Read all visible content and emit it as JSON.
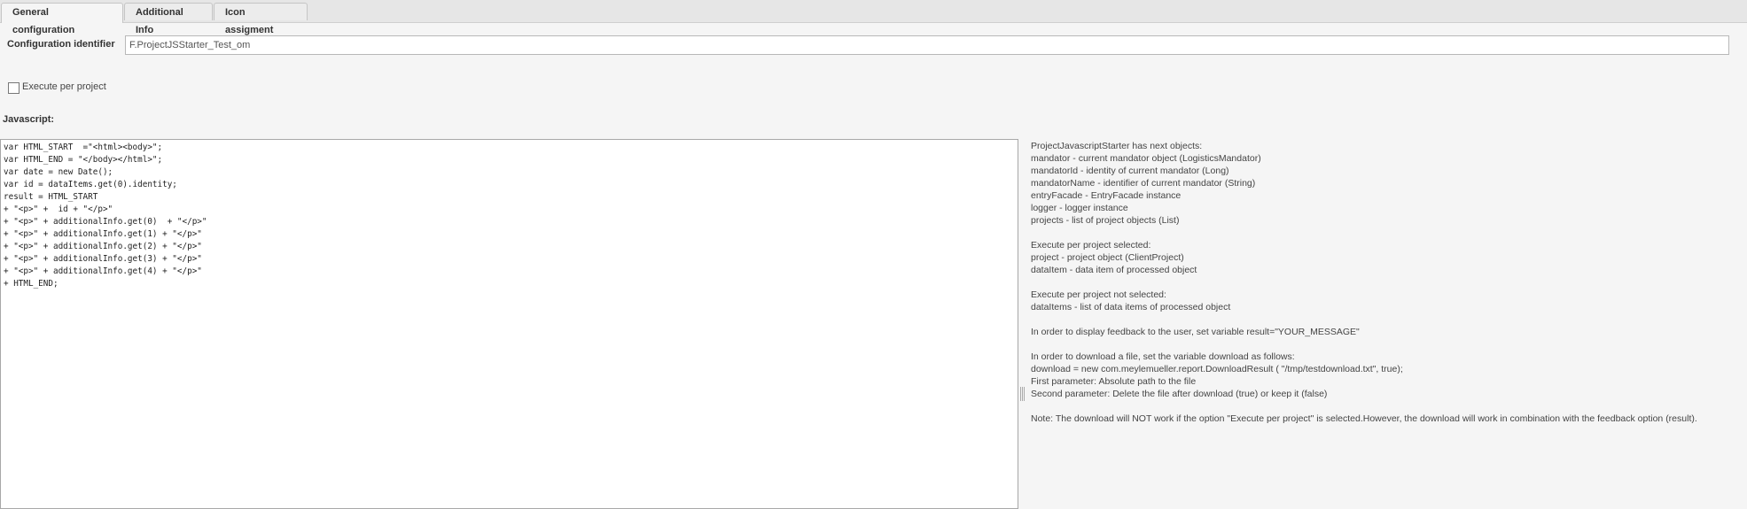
{
  "tabs": [
    {
      "label": "General configuration"
    },
    {
      "label": "Additional Info"
    },
    {
      "label": "Icon assigment"
    }
  ],
  "config": {
    "identifier_label": "Configuration identifier",
    "identifier_value": "F.ProjectJSStarter_Test_om",
    "execute_per_project_label": "Execute per project",
    "execute_per_project_checked": false,
    "javascript_label": "Javascript:"
  },
  "code_lines": [
    "var HTML_START  =\"<html><body>\";",
    "var HTML_END = \"</body></html>\";",
    "var date = new Date();",
    "var id = dataItems.get(0).identity;",
    "result = HTML_START",
    "+ \"<p>\" +  id + \"</p>\"",
    "+ \"<p>\" + additionalInfo.get(0)  + \"</p>\"",
    "+ \"<p>\" + additionalInfo.get(1) + \"</p>\"",
    "+ \"<p>\" + additionalInfo.get(2) + \"</p>\"",
    "+ \"<p>\" + additionalInfo.get(3) + \"</p>\"",
    "+ \"<p>\" + additionalInfo.get(4) + \"</p>\"",
    "+ HTML_END;"
  ],
  "help_lines": [
    "ProjectJavascriptStarter has next objects:",
    "mandator - current mandator object (LogisticsMandator)",
    "mandatorId - identity of current mandator (Long)",
    "mandatorName - identifier of current mandator (String)",
    "entryFacade - EntryFacade instance",
    "logger - logger instance",
    "projects - list of project objects (List)",
    "",
    "Execute per project selected:",
    "project - project object (ClientProject)",
    "dataItem - data item of processed object",
    "",
    "Execute per project not selected:",
    "dataItems - list of data items of processed object",
    "",
    "In order to display feedback to the user, set variable result=\"YOUR_MESSAGE\"",
    "",
    "In order to download a file, set the variable download as follows:",
    "download = new com.meylemueller.report.DownloadResult ( \"/tmp/testdownload.txt\", true);",
    "First parameter: Absolute path to the file",
    "Second parameter: Delete the file after download (true) or keep it (false)",
    "",
    "Note: The download will NOT work if the option \"Execute per project\" is selected.However, the download will work in combination with the feedback option (result)."
  ]
}
